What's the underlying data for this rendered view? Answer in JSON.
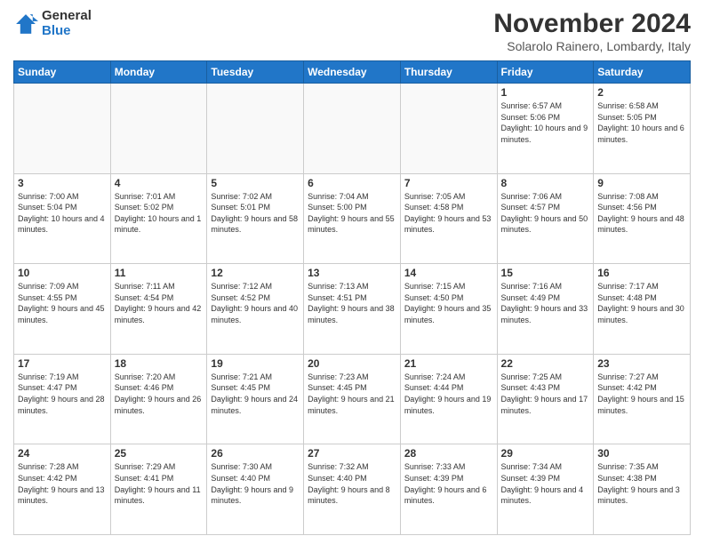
{
  "logo": {
    "general": "General",
    "blue": "Blue"
  },
  "title": "November 2024",
  "location": "Solarolo Rainero, Lombardy, Italy",
  "header_days": [
    "Sunday",
    "Monday",
    "Tuesday",
    "Wednesday",
    "Thursday",
    "Friday",
    "Saturday"
  ],
  "weeks": [
    [
      {
        "day": "",
        "info": ""
      },
      {
        "day": "",
        "info": ""
      },
      {
        "day": "",
        "info": ""
      },
      {
        "day": "",
        "info": ""
      },
      {
        "day": "",
        "info": ""
      },
      {
        "day": "1",
        "info": "Sunrise: 6:57 AM\nSunset: 5:06 PM\nDaylight: 10 hours and 9 minutes."
      },
      {
        "day": "2",
        "info": "Sunrise: 6:58 AM\nSunset: 5:05 PM\nDaylight: 10 hours and 6 minutes."
      }
    ],
    [
      {
        "day": "3",
        "info": "Sunrise: 7:00 AM\nSunset: 5:04 PM\nDaylight: 10 hours and 4 minutes."
      },
      {
        "day": "4",
        "info": "Sunrise: 7:01 AM\nSunset: 5:02 PM\nDaylight: 10 hours and 1 minute."
      },
      {
        "day": "5",
        "info": "Sunrise: 7:02 AM\nSunset: 5:01 PM\nDaylight: 9 hours and 58 minutes."
      },
      {
        "day": "6",
        "info": "Sunrise: 7:04 AM\nSunset: 5:00 PM\nDaylight: 9 hours and 55 minutes."
      },
      {
        "day": "7",
        "info": "Sunrise: 7:05 AM\nSunset: 4:58 PM\nDaylight: 9 hours and 53 minutes."
      },
      {
        "day": "8",
        "info": "Sunrise: 7:06 AM\nSunset: 4:57 PM\nDaylight: 9 hours and 50 minutes."
      },
      {
        "day": "9",
        "info": "Sunrise: 7:08 AM\nSunset: 4:56 PM\nDaylight: 9 hours and 48 minutes."
      }
    ],
    [
      {
        "day": "10",
        "info": "Sunrise: 7:09 AM\nSunset: 4:55 PM\nDaylight: 9 hours and 45 minutes."
      },
      {
        "day": "11",
        "info": "Sunrise: 7:11 AM\nSunset: 4:54 PM\nDaylight: 9 hours and 42 minutes."
      },
      {
        "day": "12",
        "info": "Sunrise: 7:12 AM\nSunset: 4:52 PM\nDaylight: 9 hours and 40 minutes."
      },
      {
        "day": "13",
        "info": "Sunrise: 7:13 AM\nSunset: 4:51 PM\nDaylight: 9 hours and 38 minutes."
      },
      {
        "day": "14",
        "info": "Sunrise: 7:15 AM\nSunset: 4:50 PM\nDaylight: 9 hours and 35 minutes."
      },
      {
        "day": "15",
        "info": "Sunrise: 7:16 AM\nSunset: 4:49 PM\nDaylight: 9 hours and 33 minutes."
      },
      {
        "day": "16",
        "info": "Sunrise: 7:17 AM\nSunset: 4:48 PM\nDaylight: 9 hours and 30 minutes."
      }
    ],
    [
      {
        "day": "17",
        "info": "Sunrise: 7:19 AM\nSunset: 4:47 PM\nDaylight: 9 hours and 28 minutes."
      },
      {
        "day": "18",
        "info": "Sunrise: 7:20 AM\nSunset: 4:46 PM\nDaylight: 9 hours and 26 minutes."
      },
      {
        "day": "19",
        "info": "Sunrise: 7:21 AM\nSunset: 4:45 PM\nDaylight: 9 hours and 24 minutes."
      },
      {
        "day": "20",
        "info": "Sunrise: 7:23 AM\nSunset: 4:45 PM\nDaylight: 9 hours and 21 minutes."
      },
      {
        "day": "21",
        "info": "Sunrise: 7:24 AM\nSunset: 4:44 PM\nDaylight: 9 hours and 19 minutes."
      },
      {
        "day": "22",
        "info": "Sunrise: 7:25 AM\nSunset: 4:43 PM\nDaylight: 9 hours and 17 minutes."
      },
      {
        "day": "23",
        "info": "Sunrise: 7:27 AM\nSunset: 4:42 PM\nDaylight: 9 hours and 15 minutes."
      }
    ],
    [
      {
        "day": "24",
        "info": "Sunrise: 7:28 AM\nSunset: 4:42 PM\nDaylight: 9 hours and 13 minutes."
      },
      {
        "day": "25",
        "info": "Sunrise: 7:29 AM\nSunset: 4:41 PM\nDaylight: 9 hours and 11 minutes."
      },
      {
        "day": "26",
        "info": "Sunrise: 7:30 AM\nSunset: 4:40 PM\nDaylight: 9 hours and 9 minutes."
      },
      {
        "day": "27",
        "info": "Sunrise: 7:32 AM\nSunset: 4:40 PM\nDaylight: 9 hours and 8 minutes."
      },
      {
        "day": "28",
        "info": "Sunrise: 7:33 AM\nSunset: 4:39 PM\nDaylight: 9 hours and 6 minutes."
      },
      {
        "day": "29",
        "info": "Sunrise: 7:34 AM\nSunset: 4:39 PM\nDaylight: 9 hours and 4 minutes."
      },
      {
        "day": "30",
        "info": "Sunrise: 7:35 AM\nSunset: 4:38 PM\nDaylight: 9 hours and 3 minutes."
      }
    ]
  ]
}
